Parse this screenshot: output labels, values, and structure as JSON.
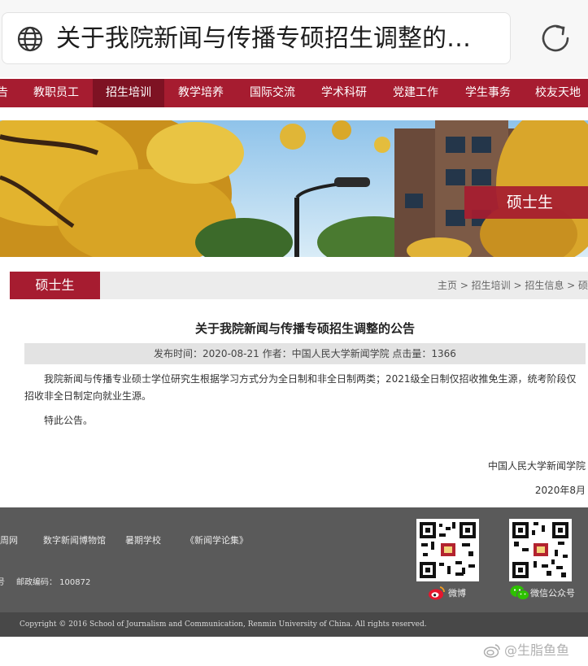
{
  "browser": {
    "address_text": "关于我院新闻与传播专硕招生调整的…"
  },
  "nav": {
    "items": [
      "告",
      "教职员工",
      "招生培训",
      "教学培养",
      "国际交流",
      "学术科研",
      "党建工作",
      "学生事务",
      "校友天地"
    ],
    "active_index": 2
  },
  "banner": {
    "tag": "硕士生"
  },
  "breadcrumb": {
    "tab_label": "硕士生",
    "path": "主页 > 招生培训 > 招生信息 > 硕士生"
  },
  "article": {
    "title": "关于我院新闻与传播专硕招生调整的公告",
    "meta": "发布时间：2020-08-21    作者：中国人民大学新闻学院    点击量：1366",
    "body": "我院新闻与传播专业硕士学位研究生根据学习方式分为全日制和非全日制两类；2021级全日制仅招收推免生源，统考阶段仅招收非全日制定向就业生源。",
    "ending": "特此公告。",
    "signature": "中国人民大学新闻学院",
    "date": "2020年8月"
  },
  "footer": {
    "links": [
      "周网",
      "数字新闻博物馆",
      "暑期学校",
      "《新闻学论集》"
    ],
    "info_fragment": "号",
    "postal_code": "邮政编码：  100872",
    "weibo_label": "微博",
    "wechat_label": "微信公众号",
    "copyright": "Copyright © 2016 School of Journalism and Communication, Renmin University of China. All rights reserved."
  },
  "watermark": "@生脂鱼鱼",
  "colors": {
    "brand_red": "#a61c30",
    "nav_active": "#7e1223",
    "footer_gray": "#5a5a5a"
  }
}
